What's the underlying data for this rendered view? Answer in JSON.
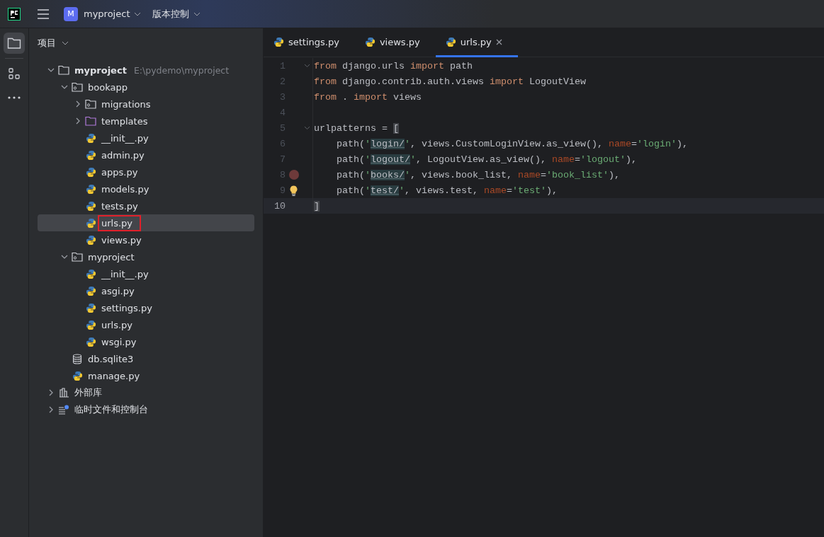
{
  "toolbar": {
    "project": {
      "badge": "M",
      "name": "myproject"
    },
    "vcs": "版本控制"
  },
  "sidebar": {
    "title": "项目",
    "tree": [
      {
        "kind": "project",
        "name": "myproject",
        "path": "E:\\pydemo\\myproject",
        "expanded": true,
        "selected": false,
        "boxed": false,
        "children": [
          {
            "kind": "module",
            "name": "bookapp",
            "expanded": true,
            "selected": false,
            "boxed": false,
            "children": [
              {
                "kind": "module",
                "name": "migrations",
                "expanded": false,
                "selected": false,
                "boxed": false
              },
              {
                "kind": "folder",
                "name": "templates",
                "expanded": false,
                "selected": false,
                "boxed": false
              },
              {
                "kind": "python",
                "name": "__init__.py",
                "selected": false,
                "boxed": false
              },
              {
                "kind": "python",
                "name": "admin.py",
                "selected": false,
                "boxed": false
              },
              {
                "kind": "python",
                "name": "apps.py",
                "selected": false,
                "boxed": false
              },
              {
                "kind": "python",
                "name": "models.py",
                "selected": false,
                "boxed": false
              },
              {
                "kind": "python",
                "name": "tests.py",
                "selected": false,
                "boxed": false
              },
              {
                "kind": "python",
                "name": "urls.py",
                "selected": true,
                "boxed": true
              },
              {
                "kind": "python",
                "name": "views.py",
                "selected": false,
                "boxed": false
              }
            ]
          },
          {
            "kind": "module",
            "name": "myproject",
            "expanded": true,
            "selected": false,
            "boxed": false,
            "children": [
              {
                "kind": "python",
                "name": "__init__.py",
                "selected": false,
                "boxed": false
              },
              {
                "kind": "python",
                "name": "asgi.py",
                "selected": false,
                "boxed": false
              },
              {
                "kind": "python",
                "name": "settings.py",
                "selected": false,
                "boxed": false
              },
              {
                "kind": "python",
                "name": "urls.py",
                "selected": false,
                "boxed": false
              },
              {
                "kind": "python",
                "name": "wsgi.py",
                "selected": false,
                "boxed": false
              }
            ]
          },
          {
            "kind": "database",
            "name": "db.sqlite3",
            "selected": false,
            "boxed": false
          },
          {
            "kind": "python",
            "name": "manage.py",
            "selected": false,
            "boxed": false
          }
        ]
      },
      {
        "kind": "library",
        "name": "外部库",
        "expanded": false,
        "selected": false,
        "boxed": false
      },
      {
        "kind": "scratch",
        "name": "临时文件和控制台",
        "expanded": false,
        "selected": false,
        "boxed": false
      }
    ]
  },
  "tabs": [
    {
      "label": "settings.py",
      "selected": false
    },
    {
      "label": "views.py",
      "selected": false
    },
    {
      "label": "urls.py",
      "selected": true
    }
  ],
  "editor": {
    "lines": [
      {
        "number": "1",
        "fold": true,
        "current": false,
        "breakpoint": false,
        "bulb": false,
        "tokens": [
          {
            "kind": "kw",
            "text": "from"
          },
          {
            "kind": "plain",
            "text": " django.urls "
          },
          {
            "kind": "kw",
            "text": "import"
          },
          {
            "kind": "plain",
            "text": " path"
          }
        ]
      },
      {
        "number": "2",
        "fold": false,
        "current": false,
        "breakpoint": false,
        "bulb": false,
        "tokens": [
          {
            "kind": "kw",
            "text": "from"
          },
          {
            "kind": "plain",
            "text": " django.contrib.auth.views "
          },
          {
            "kind": "kw",
            "text": "import"
          },
          {
            "kind": "plain",
            "text": " LogoutView"
          }
        ]
      },
      {
        "number": "3",
        "fold": false,
        "current": false,
        "breakpoint": false,
        "bulb": false,
        "tokens": [
          {
            "kind": "kw",
            "text": "from"
          },
          {
            "kind": "plain",
            "text": " . "
          },
          {
            "kind": "kw",
            "text": "import"
          },
          {
            "kind": "plain",
            "text": " views"
          }
        ]
      },
      {
        "number": "4",
        "fold": false,
        "current": false,
        "breakpoint": false,
        "bulb": false
      },
      {
        "number": "5",
        "fold": true,
        "current": false,
        "breakpoint": false,
        "bulb": false,
        "tokens": [
          {
            "kind": "plain",
            "text": "urlpatterns = "
          },
          {
            "kind": "brace",
            "text": "["
          }
        ]
      },
      {
        "number": "6",
        "fold": false,
        "current": false,
        "breakpoint": false,
        "bulb": false,
        "tokens": [
          {
            "kind": "plain",
            "text": "    path("
          },
          {
            "kind": "str",
            "text": "'"
          },
          {
            "kind": "url",
            "text": "login/"
          },
          {
            "kind": "str",
            "text": "'"
          },
          {
            "kind": "plain",
            "text": ", views.CustomLoginView.as_view(), "
          },
          {
            "kind": "param",
            "text": "name"
          },
          {
            "kind": "plain",
            "text": "="
          },
          {
            "kind": "str",
            "text": "'login'"
          },
          {
            "kind": "plain",
            "text": "),"
          }
        ]
      },
      {
        "number": "7",
        "fold": false,
        "current": false,
        "breakpoint": false,
        "bulb": false,
        "tokens": [
          {
            "kind": "plain",
            "text": "    path("
          },
          {
            "kind": "str",
            "text": "'"
          },
          {
            "kind": "url",
            "text": "logout/"
          },
          {
            "kind": "str",
            "text": "'"
          },
          {
            "kind": "plain",
            "text": ", LogoutView.as_view(), "
          },
          {
            "kind": "param",
            "text": "name"
          },
          {
            "kind": "plain",
            "text": "="
          },
          {
            "kind": "str",
            "text": "'logout'"
          },
          {
            "kind": "plain",
            "text": "),"
          }
        ]
      },
      {
        "number": "8",
        "fold": false,
        "current": false,
        "breakpoint": true,
        "bulb": false,
        "tokens": [
          {
            "kind": "plain",
            "text": "    path("
          },
          {
            "kind": "str",
            "text": "'"
          },
          {
            "kind": "url",
            "text": "books/"
          },
          {
            "kind": "str",
            "text": "'"
          },
          {
            "kind": "plain",
            "text": ", views.book_list, "
          },
          {
            "kind": "param",
            "text": "name"
          },
          {
            "kind": "plain",
            "text": "="
          },
          {
            "kind": "str",
            "text": "'book_list'"
          },
          {
            "kind": "plain",
            "text": "),"
          }
        ]
      },
      {
        "number": "9",
        "fold": false,
        "current": false,
        "breakpoint": false,
        "bulb": true,
        "tokens": [
          {
            "kind": "plain",
            "text": "    path("
          },
          {
            "kind": "str",
            "text": "'"
          },
          {
            "kind": "url",
            "text": "test/"
          },
          {
            "kind": "str",
            "text": "'"
          },
          {
            "kind": "plain",
            "text": ", views.test, "
          },
          {
            "kind": "param",
            "text": "name"
          },
          {
            "kind": "plain",
            "text": "="
          },
          {
            "kind": "str",
            "text": "'test'"
          },
          {
            "kind": "plain",
            "text": "),"
          }
        ]
      },
      {
        "number": "10",
        "fold": false,
        "current": true,
        "breakpoint": false,
        "bulb": false,
        "tokens": [
          {
            "kind": "brace",
            "text": "]"
          }
        ]
      }
    ]
  }
}
